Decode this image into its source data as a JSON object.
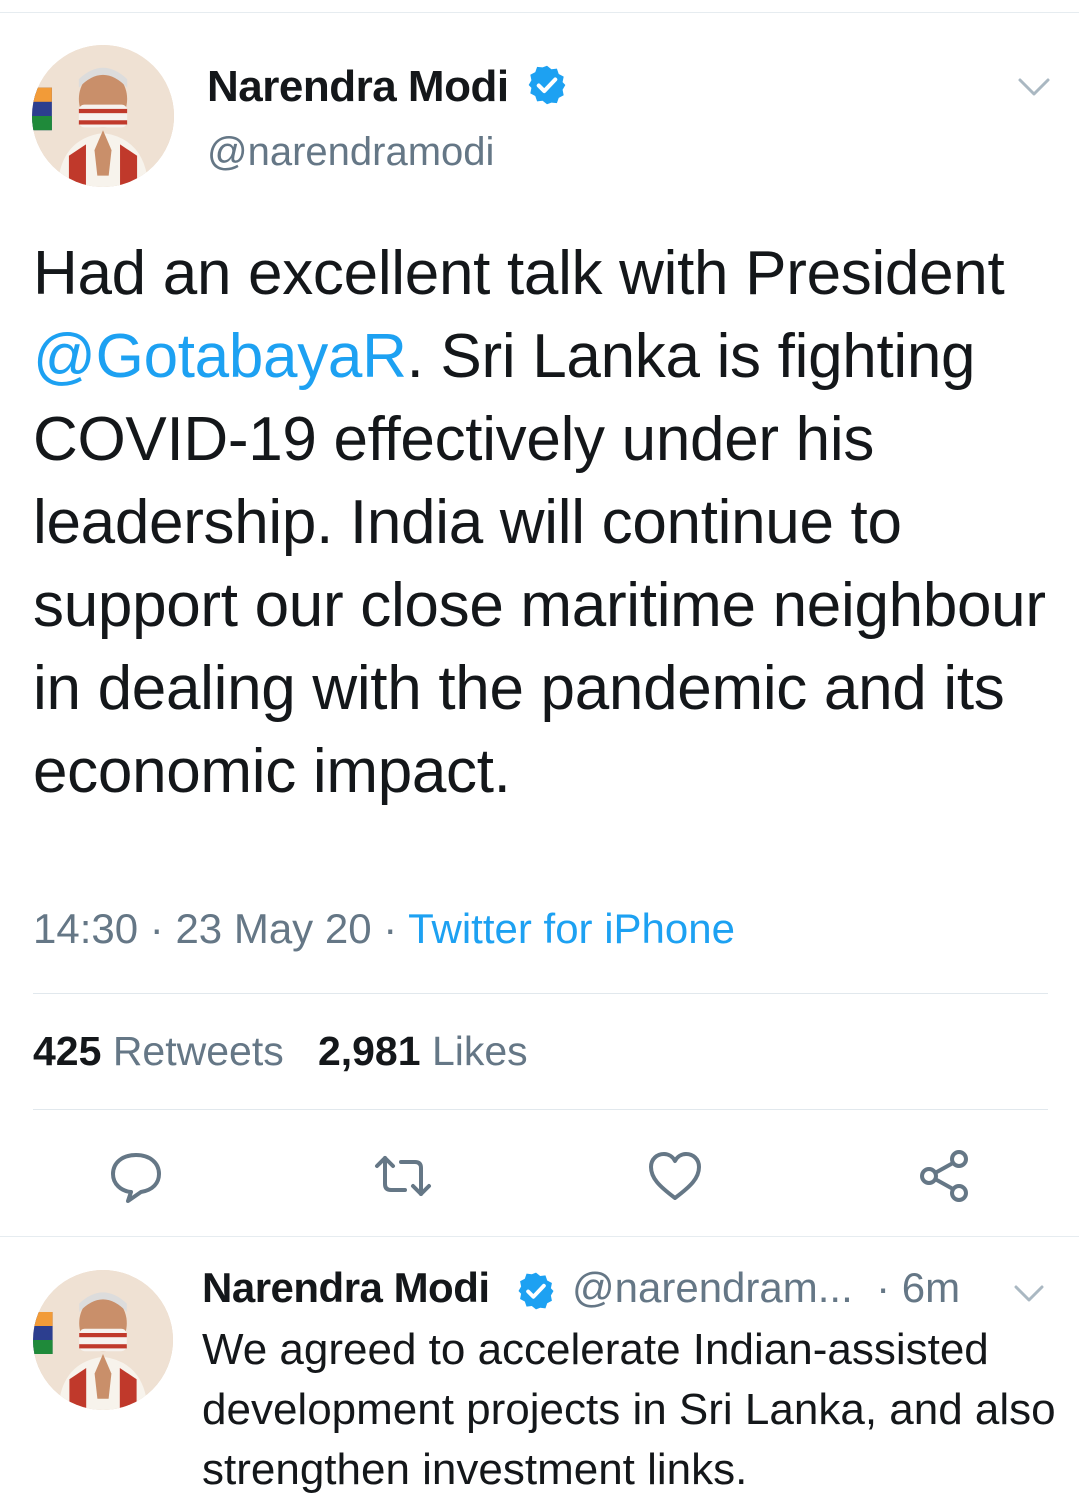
{
  "main_tweet": {
    "author_name": "Narendra Modi",
    "handle": "@narendramodi",
    "text_before_mention": "Had an excellent talk with President ",
    "mention": "@GotabayaR",
    "text_after_mention": ".  Sri Lanka is fighting COVID-19 effectively under his leadership. India will continue to support our close maritime neighbour in dealing with the pandemic and its economic impact.",
    "time": "14:30",
    "date": "23 May 20",
    "separator": "·",
    "source": "Twitter for iPhone",
    "retweets_count": "425",
    "retweets_label": "Retweets",
    "likes_count": "2,981",
    "likes_label": "Likes"
  },
  "reply_tweet": {
    "author_name": "Narendra Modi",
    "handle": "@narendram...",
    "time_ago": "· 6m",
    "text": "We agreed to accelerate Indian-assisted development projects in Sri Lanka, and also strengthen investment links."
  },
  "icons": [
    "verified-badge-icon",
    "chevron-down-icon",
    "reply-icon",
    "retweet-icon",
    "like-heart-icon",
    "share-icon"
  ],
  "colors": {
    "accent": "#1da1f2",
    "secondary_text": "#657786",
    "text": "#14171a",
    "divider": "#e1e8ed"
  }
}
